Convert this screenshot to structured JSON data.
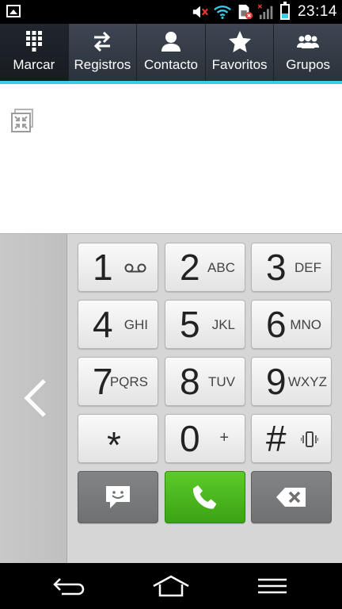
{
  "status_bar": {
    "time": "23:14",
    "icons": [
      "gallery-icon",
      "mute-icon",
      "wifi-icon",
      "no-sim-icon",
      "signal-icon",
      "battery-icon"
    ],
    "battery_level": 0.35,
    "accent": "#3ccbe8"
  },
  "tabs": [
    {
      "label": "Marcar",
      "icon": "dialpad-icon",
      "active": true
    },
    {
      "label": "Registros",
      "icon": "arrows-icon",
      "active": false
    },
    {
      "label": "Contacto",
      "icon": "person-icon",
      "active": false
    },
    {
      "label": "Favoritos",
      "icon": "star-icon",
      "active": false
    },
    {
      "label": "Grupos",
      "icon": "group-icon",
      "active": false
    }
  ],
  "display": {
    "number": "",
    "compact_icon": "compress-icon"
  },
  "keypad": {
    "keys": [
      {
        "digit": "1",
        "letters": "",
        "sub_icon": "voicemail-icon"
      },
      {
        "digit": "2",
        "letters": "ABC"
      },
      {
        "digit": "3",
        "letters": "DEF"
      },
      {
        "digit": "4",
        "letters": "GHI"
      },
      {
        "digit": "5",
        "letters": "JKL"
      },
      {
        "digit": "6",
        "letters": "MNO"
      },
      {
        "digit": "7",
        "letters": "PQRS"
      },
      {
        "digit": "8",
        "letters": "TUV"
      },
      {
        "digit": "9",
        "letters": "WXYZ"
      },
      {
        "digit": "*",
        "letters": ""
      },
      {
        "digit": "0",
        "letters": "+"
      },
      {
        "digit": "#",
        "letters": "",
        "sub_icon": "vibrate-icon"
      }
    ],
    "actions": [
      "message-icon",
      "call-icon",
      "backspace-icon"
    ],
    "call_color": "#4cb81f"
  },
  "side_panel": {
    "icon": "chevron-left-icon"
  },
  "nav_bar": {
    "buttons": [
      "back-icon",
      "home-icon",
      "menu-icon"
    ]
  }
}
